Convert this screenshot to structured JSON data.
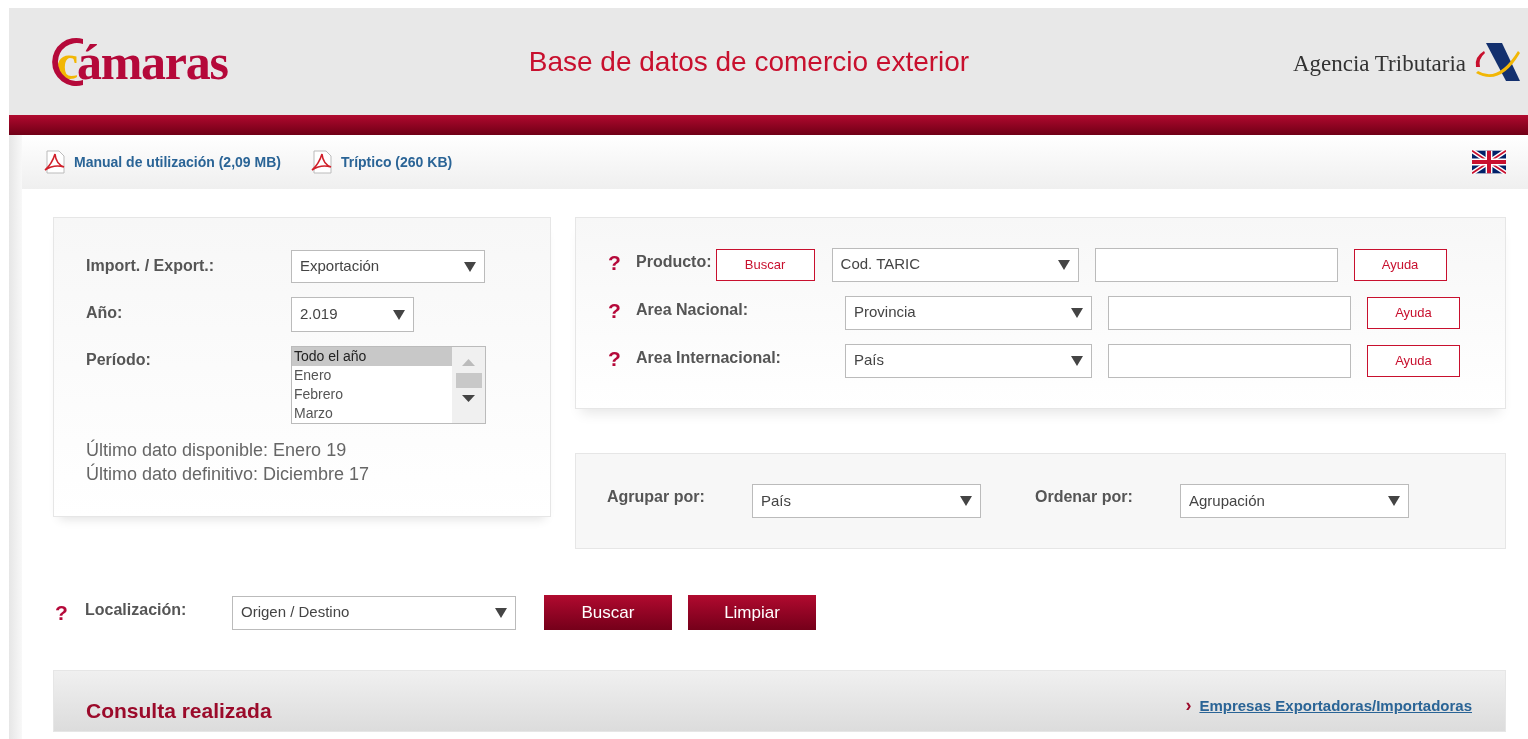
{
  "header": {
    "logo_text": "cámaras",
    "title": "Base de datos de comercio exterior",
    "agency": "Agencia Tributaria"
  },
  "downloads": [
    {
      "label": "Manual de utilización (2,09 MB)"
    },
    {
      "label": "Tríptico (260 KB)"
    }
  ],
  "left_panel": {
    "import_export": {
      "label": "Import. / Export.:",
      "value": "Exportación"
    },
    "year": {
      "label": "Año:",
      "value": "2.019"
    },
    "period": {
      "label": "Período:",
      "options": [
        {
          "label": "Todo el año",
          "selected": true
        },
        {
          "label": "Enero",
          "selected": false
        },
        {
          "label": "Febrero",
          "selected": false
        },
        {
          "label": "Marzo",
          "selected": false
        }
      ]
    },
    "info": [
      "Último dato disponible: Enero 19",
      "Último dato definitivo: Diciembre 17"
    ]
  },
  "filters": [
    {
      "help_mark": "?",
      "label": "Producto:",
      "search_button": "Buscar",
      "select_value": "Cod. TARIC",
      "help_button": "Ayuda"
    },
    {
      "help_mark": "?",
      "label": "Area Nacional:",
      "select_value": "Provincia",
      "help_button": "Ayuda"
    },
    {
      "help_mark": "?",
      "label": "Area Internacional:",
      "select_value": "País",
      "help_button": "Ayuda"
    }
  ],
  "grouping": [
    {
      "label": "Agrupar por:",
      "value": "País"
    },
    {
      "label": "Ordenar por:",
      "value": "Agrupación"
    }
  ],
  "location": {
    "help_mark": "?",
    "label": "Localización:",
    "value": "Origen / Destino"
  },
  "actions": [
    "Buscar",
    "Limpiar"
  ],
  "results": {
    "title": "Consulta realizada",
    "link_marker": "›",
    "link": "Empresas Exportadoras/Importadoras"
  }
}
